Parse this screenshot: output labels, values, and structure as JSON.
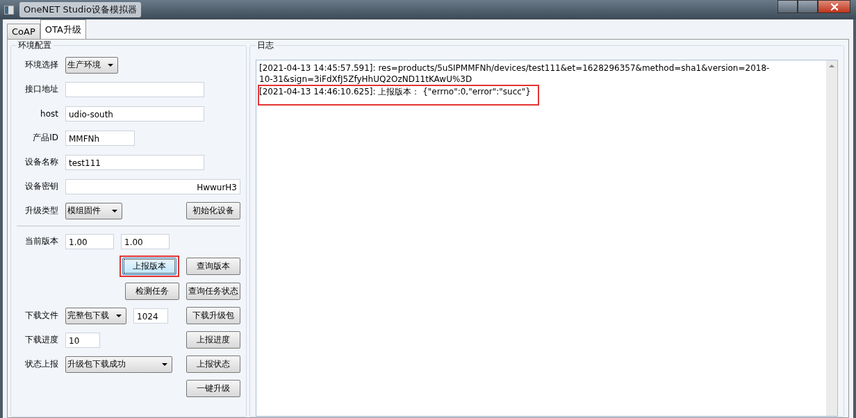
{
  "window": {
    "title": "OneNET Studio设备模拟器"
  },
  "tabs": [
    {
      "label": "CoAP",
      "selected": false
    },
    {
      "label": "OTA升级",
      "selected": true
    }
  ],
  "config": {
    "title": "环境配置",
    "env": {
      "label": "环境选择",
      "value": "生产环境"
    },
    "api_address": {
      "label": "接口地址"
    },
    "host": {
      "label": "host",
      "value": "udio-south"
    },
    "product_id": {
      "label": "产品ID",
      "value": "MMFNh"
    },
    "device_name": {
      "label": "设备名称",
      "value": "test111"
    },
    "device_key": {
      "label": "设备密钥",
      "value": "HwwurH3"
    },
    "upgrade_type": {
      "label": "升级类型",
      "value": "模组固件"
    },
    "init_button": {
      "label": "初始化设备"
    },
    "current_version": {
      "label": "当前版本",
      "value_1": "1.00",
      "value_2": "1.00"
    },
    "report_version_button": {
      "label": "上报版本",
      "highlighted": true,
      "focused": true
    },
    "query_version_button": {
      "label": "查询版本"
    },
    "check_task_button": {
      "label": "检测任务"
    },
    "query_task_button": {
      "label": "查询任务状态"
    },
    "download_file": {
      "label": "下载文件",
      "value": "完整包下载",
      "size": "1024"
    },
    "download_button": {
      "label": "下载升级包"
    },
    "download_progress": {
      "label": "下载进度",
      "value": "10"
    },
    "report_progress_button": {
      "label": "上报进度"
    },
    "status_report": {
      "label": "状态上报",
      "value": "升级包下载成功"
    },
    "report_status_button": {
      "label": "上报状态"
    },
    "one_click_button": {
      "label": "一键升级"
    }
  },
  "log": {
    "title": "日志",
    "entries": [
      {
        "text": "[2021-04-13 14:45:57.591]: res=products/5uSIPMMFNh/devices/test111&et=1628296357&method=sha1&version=2018-10-31&sign=3iFdXfJ5ZfyHhUQ2OzND11tKAwU%3D",
        "highlighted": false
      },
      {
        "text": "[2021-04-13 14:46:10.625]: 上报版本： {\"errno\":0,\"error\":\"succ\"}",
        "highlighted": true
      }
    ]
  }
}
